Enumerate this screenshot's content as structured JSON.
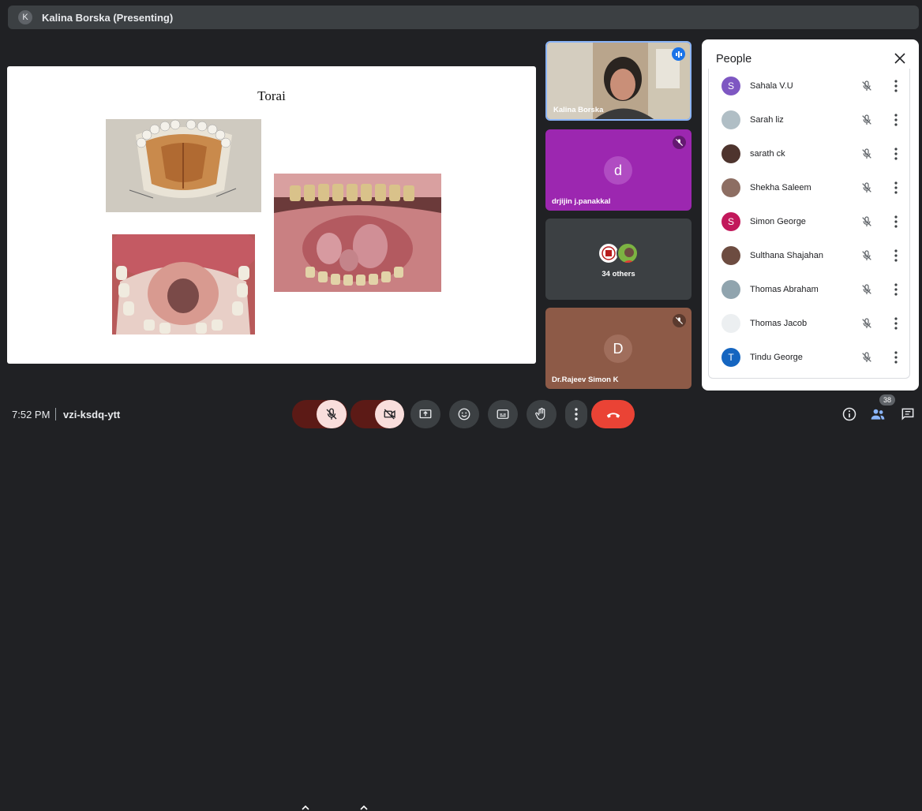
{
  "topbar": {
    "badge": "K",
    "title": "Kalina Borska (Presenting)"
  },
  "slide": {
    "title": "Torai"
  },
  "tiles": [
    {
      "name": "Kalina Borska"
    },
    {
      "name": "drjijin j.panakkal",
      "initial": "d"
    },
    {
      "name": "34 others"
    },
    {
      "name": "Dr.Rajeev Simon K",
      "initial": "D"
    }
  ],
  "people": {
    "title": "People",
    "list": [
      {
        "name": "Sahala V.U",
        "initial": "S",
        "color": "#7e57c2"
      },
      {
        "name": "Sarah liz",
        "initial": "",
        "color": "#b0bec5"
      },
      {
        "name": "sarath ck",
        "initial": "",
        "color": "#4e342e"
      },
      {
        "name": "Shekha Saleem",
        "initial": "",
        "color": "#8d6e63"
      },
      {
        "name": "Simon George",
        "initial": "S",
        "color": "#c2185b"
      },
      {
        "name": "Sulthana Shajahan",
        "initial": "",
        "color": "#6d4c41"
      },
      {
        "name": "Thomas Abraham",
        "initial": "",
        "color": "#90a4ae"
      },
      {
        "name": "Thomas Jacob",
        "initial": "",
        "color": "#eceff1"
      },
      {
        "name": "Tindu George",
        "initial": "T",
        "color": "#1565c0"
      }
    ]
  },
  "bottom": {
    "time": "7:52 PM",
    "meeting_code": "vzi-ksdq-ytt",
    "participant_count": "38"
  },
  "colors": {
    "end_call": "#ea4335",
    "muted_bg": "#f9dedc",
    "muted_arrow_bg": "#5c1a16"
  }
}
